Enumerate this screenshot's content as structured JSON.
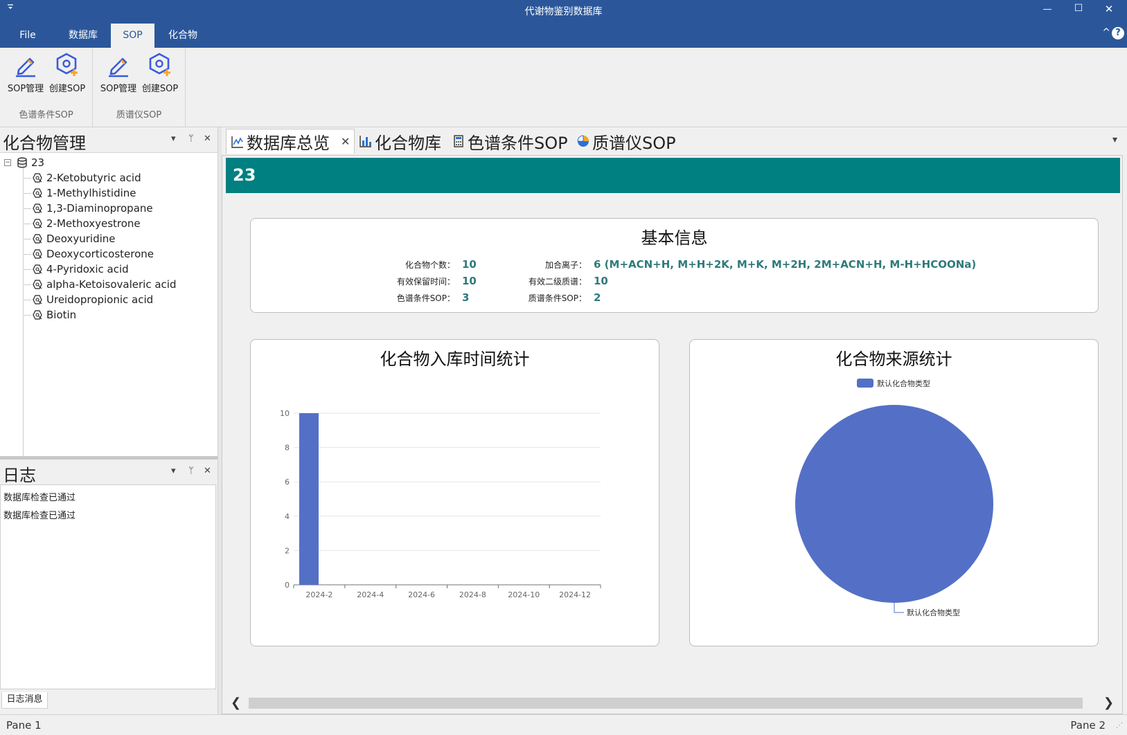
{
  "window": {
    "title": "代谢物鉴别数据库",
    "quick_access_icon": "dropdown-caret-icon",
    "minimize": "—",
    "maximize": "☐",
    "close": "✕"
  },
  "ribbon": {
    "tabs": [
      {
        "label": "File",
        "active": false
      },
      {
        "label": "数据库",
        "active": false
      },
      {
        "label": "SOP",
        "active": true
      },
      {
        "label": "化合物",
        "active": false
      }
    ],
    "collapse": "^",
    "help": "?",
    "groups": [
      {
        "label": "色谱条件SOP",
        "buttons": [
          {
            "label": "SOP管理",
            "icon": "edit-pencil-icon"
          },
          {
            "label": "创建SOP",
            "icon": "hexagon-add-icon"
          }
        ]
      },
      {
        "label": "质谱仪SOP",
        "buttons": [
          {
            "label": "SOP管理",
            "icon": "edit-pencil-icon"
          },
          {
            "label": "创建SOP",
            "icon": "hexagon-add-icon"
          }
        ]
      }
    ]
  },
  "compound_panel": {
    "title": "化合物管理",
    "root": {
      "label": "23",
      "expander": "−",
      "icon": "database-icon"
    },
    "items": [
      "2-Ketobutyric acid",
      "1-Methylhistidine",
      "1,3-Diaminopropane",
      "2-Methoxyestrone",
      "Deoxyuridine",
      "Deoxycorticosterone",
      "4-Pyridoxic acid",
      "alpha-Ketoisovaleric acid",
      "Ureidopropionic acid",
      "Biotin"
    ]
  },
  "log_panel": {
    "title": "日志",
    "lines": [
      "数据库检查已通过",
      "数据库检查已通过"
    ],
    "tab": "日志消息"
  },
  "panel_controls": {
    "menu": "▾",
    "pin": "ᛘ",
    "close": "✕"
  },
  "doc_tabs": [
    {
      "label": "数据库总览",
      "icon": "line-chart-icon",
      "active": true,
      "close": "✕"
    },
    {
      "label": "化合物库",
      "icon": "bar-chart-icon",
      "active": false
    },
    {
      "label": "色谱条件SOP",
      "icon": "calculator-icon",
      "active": false
    },
    {
      "label": "质谱仪SOP",
      "icon": "pie-chart-icon",
      "active": false
    }
  ],
  "doc_tabs_more": "▾",
  "overview": {
    "banner": "23",
    "basic_info": {
      "title": "基本信息",
      "left": [
        {
          "key": "化合物个数：",
          "value": "10"
        },
        {
          "key": "有效保留时间：",
          "value": "10"
        },
        {
          "key": "色谱条件SOP：",
          "value": "3"
        }
      ],
      "right": [
        {
          "key": "加合离子：",
          "value": "6 (M+ACN+H, M+H+2K, M+K, M+2H, 2M+ACN+H, M-H+HCOONa)"
        },
        {
          "key": "有效二级质谱：",
          "value": "10"
        },
        {
          "key": "质谱条件SOP：",
          "value": "2"
        }
      ]
    },
    "accent_color": "#008080",
    "value_color": "#2f7a7a"
  },
  "scrollbar": {
    "left": "❮",
    "right": "❯"
  },
  "status": {
    "left": "Pane 1",
    "right": "Pane 2",
    "grip": "⋰"
  },
  "chart_data": [
    {
      "type": "bar",
      "title": "化合物入库时间统计",
      "x_ticks": [
        "2024-2",
        "2024-4",
        "2024-6",
        "2024-8",
        "2024-10",
        "2024-12"
      ],
      "y_ticks": [
        0,
        2,
        4,
        6,
        8,
        10
      ],
      "ylim": [
        0,
        10
      ],
      "xlim": [
        "2024-2",
        "2024-12"
      ],
      "values": [
        {
          "x": "2024-2",
          "y": 10
        }
      ],
      "color": "#5470c6",
      "grid": true,
      "xlabel": "",
      "ylabel": ""
    },
    {
      "type": "pie",
      "title": "化合物来源统计",
      "legend": [
        "默认化合物类型"
      ],
      "legend_position": "top-center",
      "slices": [
        {
          "name": "默认化合物类型",
          "value": 10
        }
      ],
      "color": "#5470c6"
    }
  ]
}
